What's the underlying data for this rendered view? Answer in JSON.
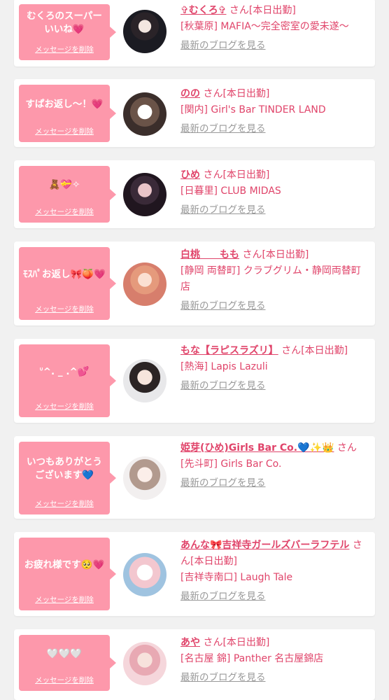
{
  "delete_label": "メッセージを削除",
  "san_label": "さん",
  "status_label": "[本日出勤]",
  "blog_label": "最新のブログを見る",
  "colors": {
    "bubble": "#fd98ab",
    "name": "#e0446a",
    "link_gray": "#999999",
    "background": "#f1f1f1"
  },
  "entries": [
    {
      "message": "むくろのスーパーいいね💗",
      "name": "✞むくろ✞",
      "area": "[秋葉原]",
      "shop": "MAFIA〜完全密室の愛未遂〜"
    },
    {
      "message": "すぱお返し〜！💗",
      "name": "のの",
      "area": "[関内]",
      "shop": "Girl's Bar TINDER LAND"
    },
    {
      "message": "🧸💝✧",
      "name": "ひめ",
      "area": "[日暮里]",
      "shop": "CLUB MIDAS"
    },
    {
      "message": "ﾓｽﾊﾟお返し🎀🍑💗",
      "name": "白桃　　もも",
      "area": "[静岡 両替町]",
      "shop": "クラブグリム・静岡両替町店"
    },
    {
      "message": "ᐡ^. _ .^💕",
      "name": "もな【ラピスラズリ】",
      "area": "[熱海]",
      "shop": "Lapis Lazuli"
    },
    {
      "message": "いつもありがとうございます💙",
      "name": "姫芽(ひめ)Girls Bar Co.💙✨👑",
      "area": "[先斗町]",
      "shop": "Girls Bar Co."
    },
    {
      "message": "お疲れ様です🥺💗",
      "name": "あんな🎀吉祥寺ガールズバーラフテル",
      "area": "[吉祥寺南口]",
      "shop": "Laugh Tale"
    },
    {
      "message": "🤍🤍🤍",
      "name": "あや",
      "area": "[名古屋 錦]",
      "shop": "Panther 名古屋錦店"
    }
  ]
}
